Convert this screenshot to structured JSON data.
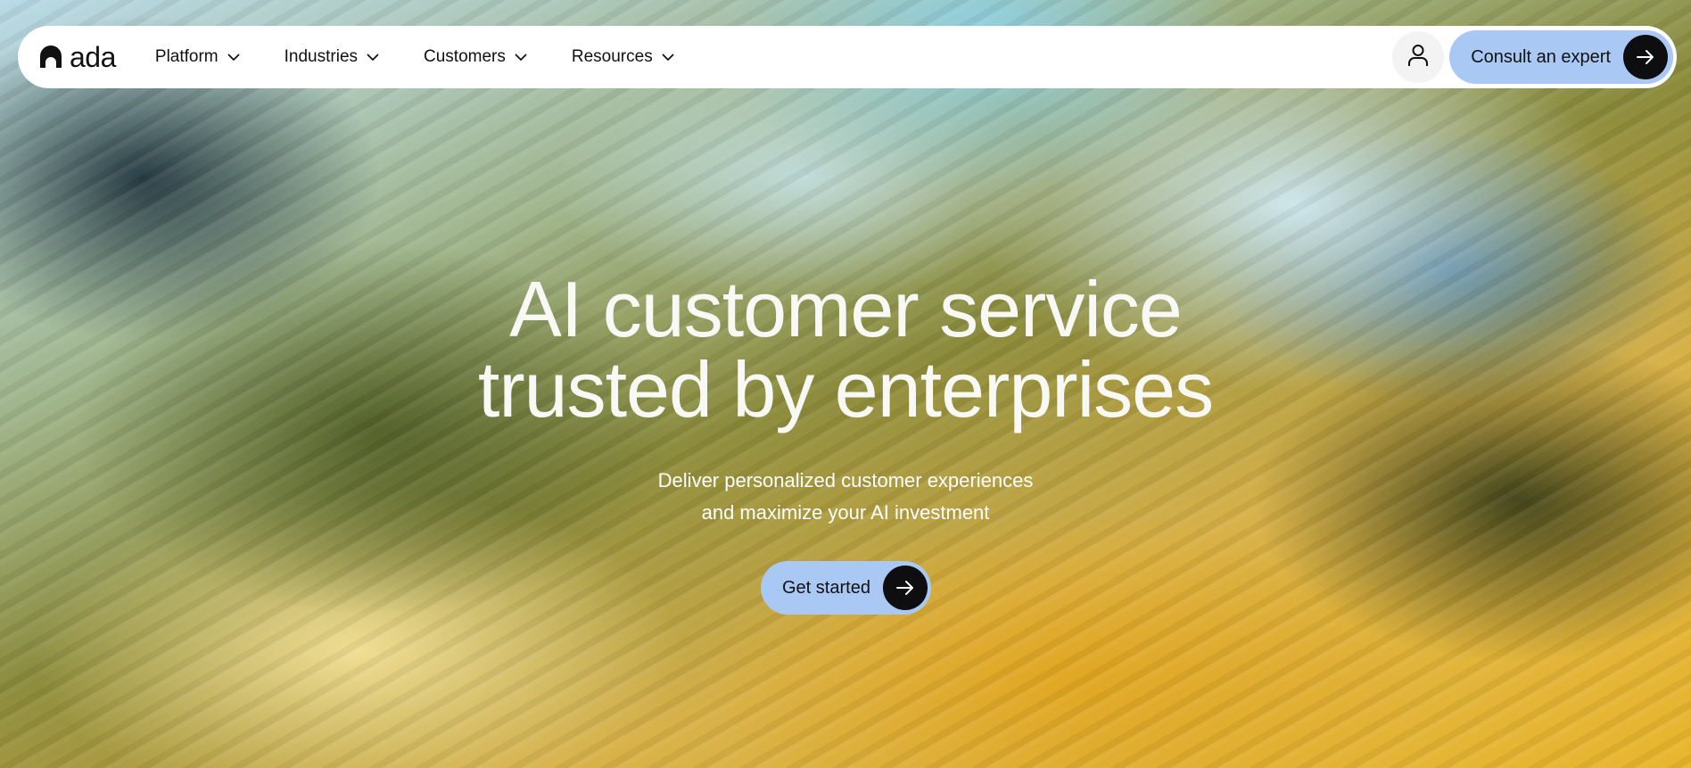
{
  "colors": {
    "accent": "#a9c8f3",
    "dark": "#0e0e10",
    "nav_bg": "#ffffff"
  },
  "header": {
    "logo_icon": "ada-arch-icon",
    "logo_text": "ada",
    "menu": [
      {
        "label": "Platform",
        "icon": "chevron-down-icon"
      },
      {
        "label": "Industries",
        "icon": "chevron-down-icon"
      },
      {
        "label": "Customers",
        "icon": "chevron-down-icon"
      },
      {
        "label": "Resources",
        "icon": "chevron-down-icon"
      }
    ],
    "account_icon": "user-icon",
    "cta_label": "Consult an expert",
    "cta_icon": "arrow-right-icon"
  },
  "hero": {
    "title_line1": "AI customer service",
    "title_line2": "trusted by enterprises",
    "subtitle_line1": "Deliver personalized customer experiences",
    "subtitle_line2": "and maximize your AI investment",
    "cta_label": "Get started",
    "cta_icon": "arrow-right-icon"
  }
}
